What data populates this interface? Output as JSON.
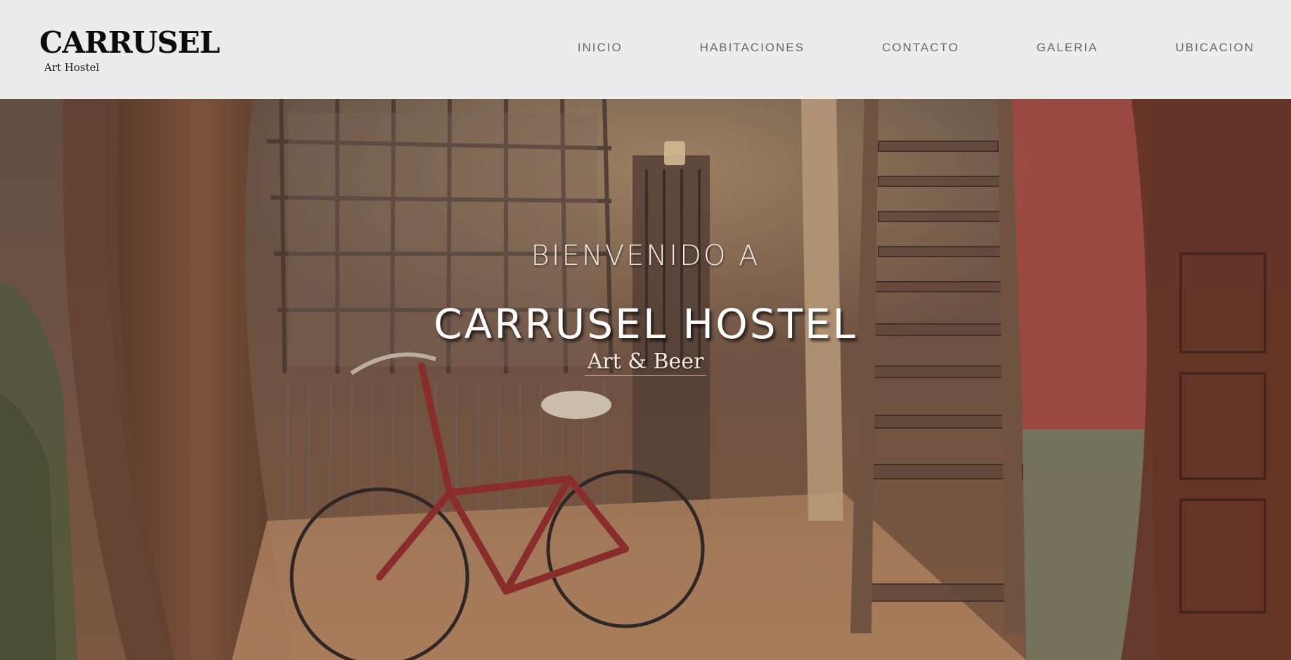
{
  "header": {
    "logo_title": "CARRUSEL",
    "logo_subtitle": "Art Hostel",
    "nav": [
      {
        "label": "INICIO"
      },
      {
        "label": "HABITACIONES"
      },
      {
        "label": "CONTACTO"
      },
      {
        "label": "GALERIA"
      },
      {
        "label": "UBICACION"
      }
    ]
  },
  "hero": {
    "pretitle": "BIENVENIDO A",
    "title": "CARRUSEL HOSTEL",
    "tagline": "Art & Beer",
    "image_subject": "hostel-courtyard-photo"
  },
  "colors": {
    "header_bg": "#ececec",
    "nav_text": "#6a6a6a",
    "logo_text": "#0b0b0b",
    "hero_text": "#ffffff"
  }
}
